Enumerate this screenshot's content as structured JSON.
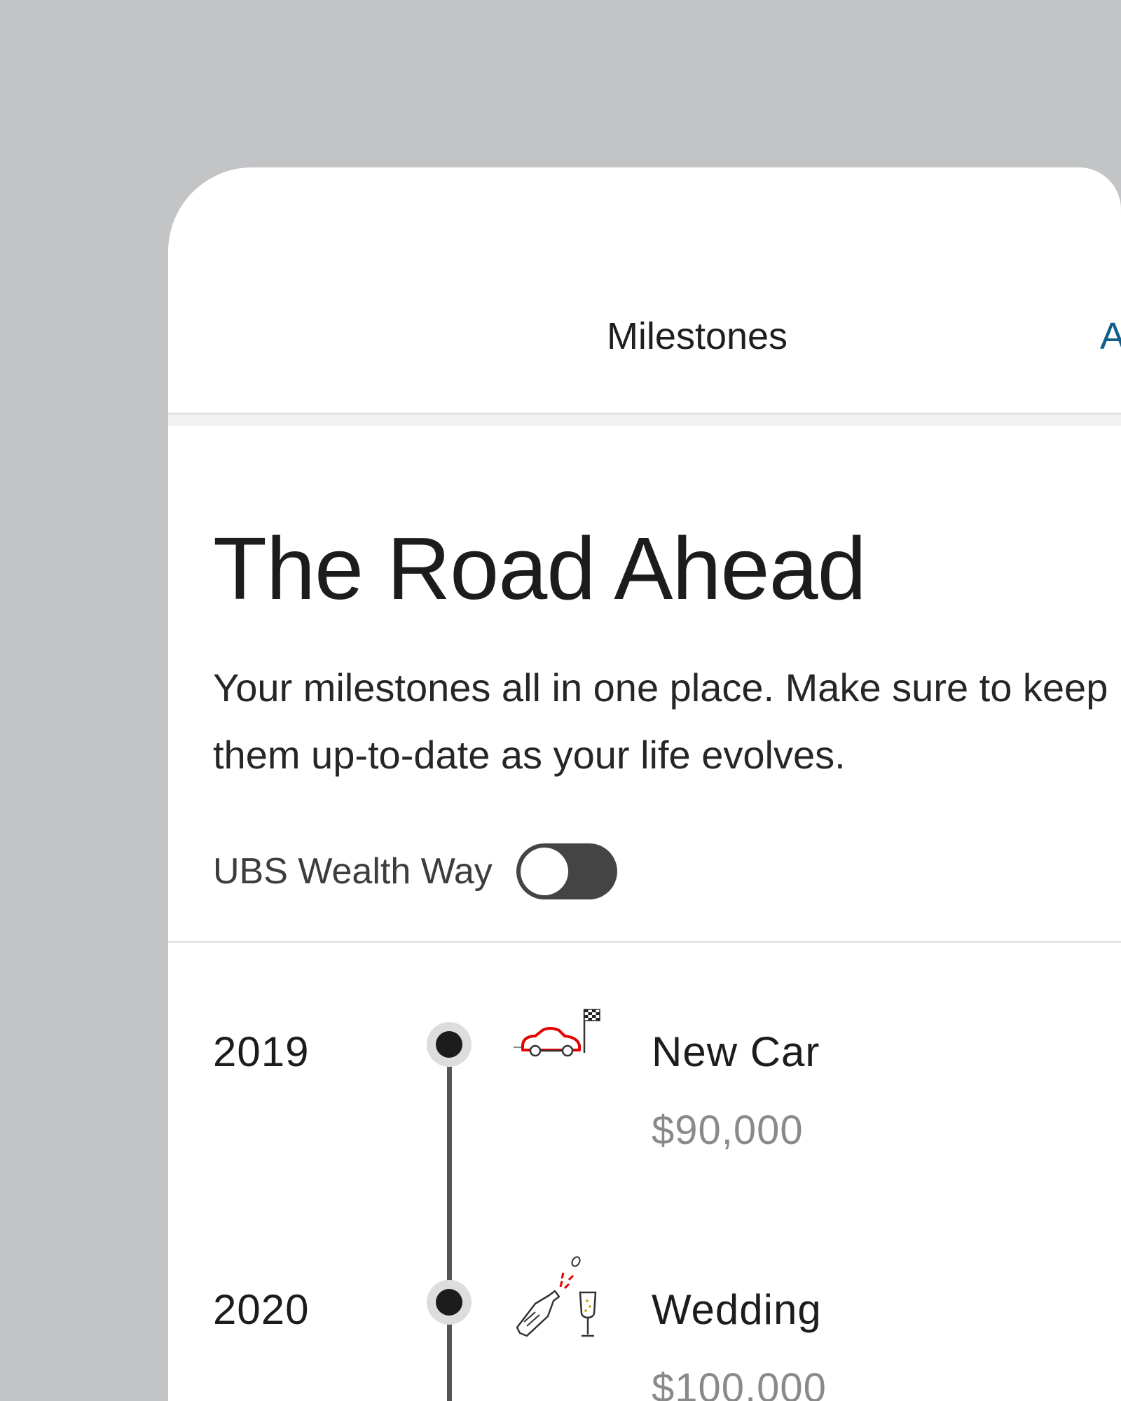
{
  "header": {
    "title": "Milestones",
    "action_label": "A"
  },
  "main": {
    "title": "The Road Ahead",
    "subtitle": "Your milestones all in one place. Make sure to keep them up-to-date as your life evolves.",
    "toggle": {
      "label": "UBS Wealth Way",
      "state": "off"
    }
  },
  "milestones": [
    {
      "year": "2019",
      "name": "New Car",
      "amount": "$90,000",
      "icon": "car-finish-flag-icon"
    },
    {
      "year": "2020",
      "name": "Wedding",
      "amount": "$100,000",
      "icon": "champagne-bottle-glass-icon"
    }
  ],
  "colors": {
    "background": "#c3c4c6",
    "card": "#ffffff",
    "accent": "#0f5f8c",
    "icon_red": "#e60000",
    "toggle_off": "#444444",
    "amount_gray": "#8a8a8a"
  }
}
